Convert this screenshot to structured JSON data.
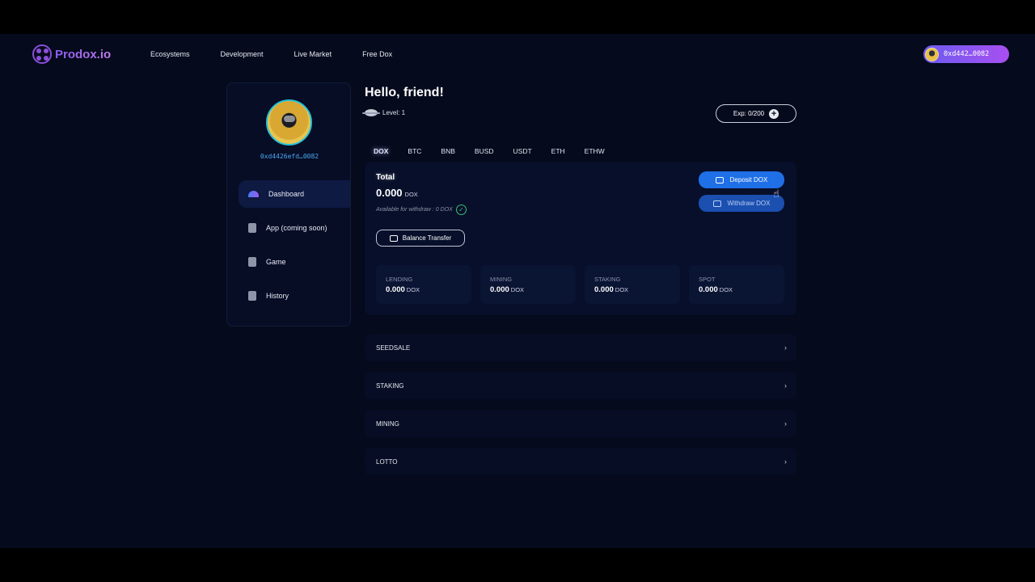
{
  "header": {
    "logo_text": "Prodox.io",
    "nav": [
      "Ecosystems",
      "Development",
      "Live Market",
      "Free Dox"
    ],
    "wallet_address": "0xd442…0082"
  },
  "sidebar": {
    "address": "0xd4426efd…0082",
    "items": [
      {
        "label": "Dashboard",
        "icon": "dashboard-icon",
        "active": true
      },
      {
        "label": "App (coming soon)",
        "icon": "phone-icon"
      },
      {
        "label": "Game",
        "icon": "phone-icon"
      },
      {
        "label": "History",
        "icon": "document-icon"
      }
    ]
  },
  "main": {
    "greeting": "Hello, friend!",
    "level_label": "Level: 1",
    "exp_label": "Exp: 0/200",
    "tabs": [
      "DOX",
      "BTC",
      "BNB",
      "BUSD",
      "USDT",
      "ETH",
      "ETHW"
    ],
    "active_tab": "DOX",
    "total_label": "Total",
    "total_value": "0.000",
    "total_unit": "DOX",
    "available_text": "Available for withdraw :  0  DOX",
    "balance_transfer_label": "Balance Transfer",
    "deposit_label": "Deposit DOX",
    "withdraw_label": "Withdraw DOX",
    "stats": [
      {
        "label": "LENDING",
        "value": "0.000",
        "unit": "DOX"
      },
      {
        "label": "MINING",
        "value": "0.000",
        "unit": "DOX"
      },
      {
        "label": "STAKING",
        "value": "0.000",
        "unit": "DOX"
      },
      {
        "label": "SPOT",
        "value": "0.000",
        "unit": "DOX"
      }
    ],
    "sections": [
      "SEEDSALE",
      "STAKING",
      "MINING",
      "LOTTO"
    ]
  },
  "colors": {
    "background": "#050a1c",
    "accent_blue": "#1f6fe6",
    "accent_purple": "#a84ff0",
    "address_cyan": "#4aa8f0"
  }
}
